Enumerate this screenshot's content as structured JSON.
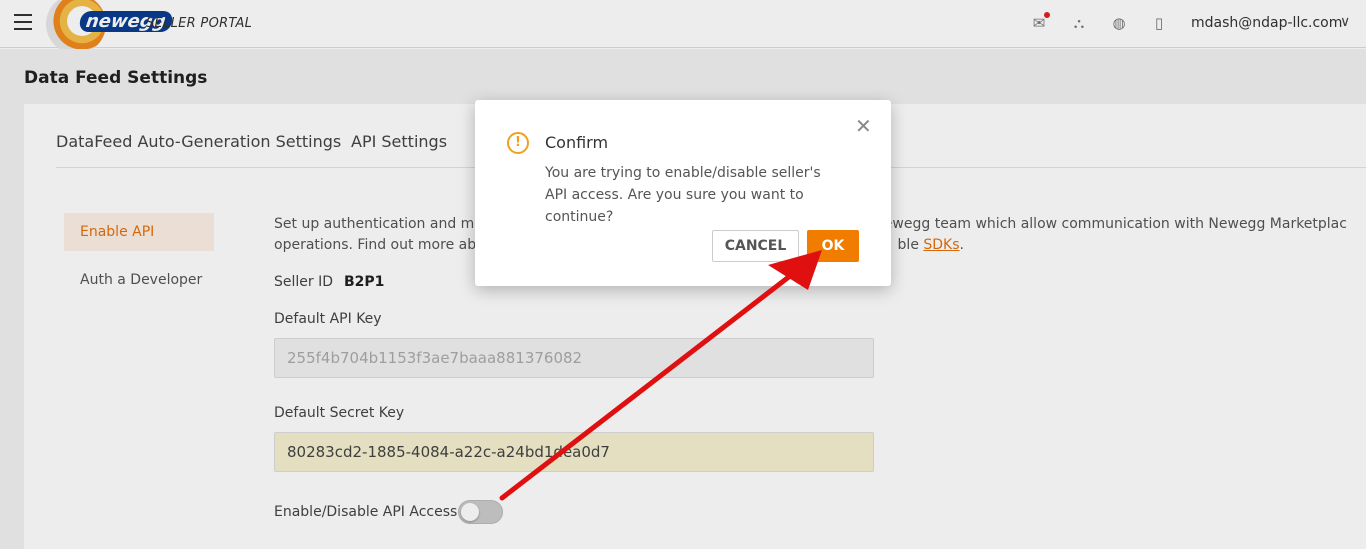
{
  "header": {
    "logo_word": "newegg",
    "logo_suffix": "SELLER PORTAL",
    "user_email": "mdash@ndap-llc.com"
  },
  "page": {
    "title": "Data Feed Settings",
    "tabs": [
      {
        "label": "DataFeed Auto-Generation Settings"
      },
      {
        "label": "API Settings"
      }
    ],
    "sidebar": [
      {
        "label": "Enable API",
        "active": true
      },
      {
        "label": "Auth a Developer",
        "active": false
      }
    ],
    "description_line1": "Set up authentication and man",
    "description_line1_end": "ed by Newegg team which allow communication with Newegg Marketplac",
    "description_line2": "operations. Find out more abou",
    "description_line2_end": "ble ",
    "description_link": "SDKs",
    "description_period": ".",
    "seller_id_label": "Seller ID",
    "seller_id_value": "B2P1",
    "api_key_label": "Default API Key",
    "api_key_value": "255f4b704b1153f3ae7baaa881376082",
    "secret_key_label": "Default Secret Key",
    "secret_key_value": "80283cd2-1885-4084-a22c-a24bd1dea0d7",
    "toggle_label": "Enable/Disable API Access",
    "toggle_on": false
  },
  "dialog": {
    "title": "Confirm",
    "message": "You are trying to enable/disable seller's API access. Are you sure you want to continue?",
    "cancel_label": "CANCEL",
    "ok_label": "OK"
  },
  "colors": {
    "accent": "#f07c00",
    "warning": "#f0a020",
    "annotation_arrow": "#e01010"
  }
}
